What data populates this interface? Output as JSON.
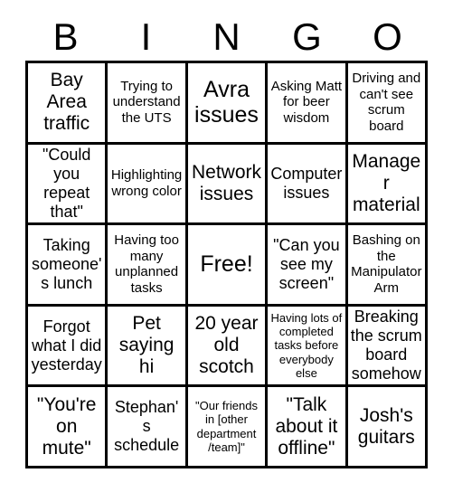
{
  "card": {
    "title": "BINGO",
    "header_letters": [
      "B",
      "I",
      "N",
      "G",
      "O"
    ],
    "grid_size": "5x5",
    "colors": {
      "border": "#000000",
      "cell_background": "#ffffff",
      "text": "#000000",
      "page_background": "#ffffff"
    },
    "cells": [
      {
        "id": "cell-b1",
        "column": "B",
        "row": 1,
        "text": "Bay Area traffic",
        "size": "lg"
      },
      {
        "id": "cell-i1",
        "column": "I",
        "row": 1,
        "text": "Trying to understand the UTS",
        "size": "sm"
      },
      {
        "id": "cell-n1",
        "column": "N",
        "row": 1,
        "text": "Avra issues",
        "size": "xl"
      },
      {
        "id": "cell-g1",
        "column": "G",
        "row": 1,
        "text": "Asking Matt for beer wisdom",
        "size": "sm"
      },
      {
        "id": "cell-o1",
        "column": "O",
        "row": 1,
        "text": "Driving and can't see scrum board",
        "size": "sm"
      },
      {
        "id": "cell-b2",
        "column": "B",
        "row": 2,
        "text": "\"Could you repeat that\"",
        "size": "md"
      },
      {
        "id": "cell-i2",
        "column": "I",
        "row": 2,
        "text": "Highlighting wrong color",
        "size": "sm"
      },
      {
        "id": "cell-n2",
        "column": "N",
        "row": 2,
        "text": "Network issues",
        "size": "lg"
      },
      {
        "id": "cell-g2",
        "column": "G",
        "row": 2,
        "text": "Computer issues",
        "size": "md"
      },
      {
        "id": "cell-o2",
        "column": "O",
        "row": 2,
        "text": "Manager material",
        "size": "lg"
      },
      {
        "id": "cell-b3",
        "column": "B",
        "row": 3,
        "text": "Taking someone's lunch",
        "size": "md"
      },
      {
        "id": "cell-i3",
        "column": "I",
        "row": 3,
        "text": "Having too many unplanned tasks",
        "size": "sm"
      },
      {
        "id": "cell-n3",
        "column": "N",
        "row": 3,
        "text": "Free!",
        "size": "xl"
      },
      {
        "id": "cell-g3",
        "column": "G",
        "row": 3,
        "text": "\"Can you see my screen\"",
        "size": "md"
      },
      {
        "id": "cell-o3",
        "column": "O",
        "row": 3,
        "text": "Bashing on the Manipulator Arm",
        "size": "sm"
      },
      {
        "id": "cell-b4",
        "column": "B",
        "row": 4,
        "text": "Forgot what I did yesterday",
        "size": "md"
      },
      {
        "id": "cell-i4",
        "column": "I",
        "row": 4,
        "text": "Pet saying hi",
        "size": "lg"
      },
      {
        "id": "cell-n4",
        "column": "N",
        "row": 4,
        "text": "20 year old scotch",
        "size": "lg"
      },
      {
        "id": "cell-g4",
        "column": "G",
        "row": 4,
        "text": "Having lots of completed tasks before everybody else",
        "size": "xs"
      },
      {
        "id": "cell-o4",
        "column": "O",
        "row": 4,
        "text": "Breaking the scrum board somehow",
        "size": "md"
      },
      {
        "id": "cell-b5",
        "column": "B",
        "row": 5,
        "text": "\"You're on mute\"",
        "size": "lg"
      },
      {
        "id": "cell-i5",
        "column": "I",
        "row": 5,
        "text": "Stephan's schedule",
        "size": "md"
      },
      {
        "id": "cell-n5",
        "column": "N",
        "row": 5,
        "text": "\"Our friends in [other department /team]\"",
        "size": "xs"
      },
      {
        "id": "cell-g5",
        "column": "G",
        "row": 5,
        "text": "\"Talk about it offline\"",
        "size": "lg"
      },
      {
        "id": "cell-o5",
        "column": "O",
        "row": 5,
        "text": "Josh's guitars",
        "size": "lg"
      }
    ]
  }
}
